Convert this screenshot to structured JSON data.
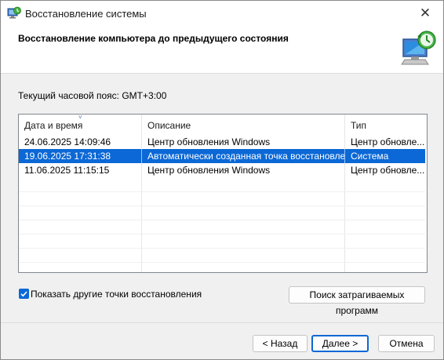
{
  "window": {
    "title": "Восстановление системы",
    "close_glyph": "✕",
    "icon": "system-restore-icon"
  },
  "header": {
    "title": "Восстановление компьютера до предыдущего состояния",
    "icon": "computer-restore-icon"
  },
  "timezone_label": "Текущий часовой пояс: GMT+3:00",
  "table": {
    "columns": [
      "Дата и время",
      "Описание",
      "Тип"
    ],
    "sort_indicator": "˅",
    "rows": [
      {
        "date": "24.06.2025 14:09:46",
        "description": "Центр обновления Windows",
        "type": "Центр обновле..."
      },
      {
        "date": "19.06.2025 17:31:38",
        "description": "Автоматически созданная точка восстановле...",
        "type": "Система"
      },
      {
        "date": "11.06.2025 11:15:15",
        "description": "Центр обновления Windows",
        "type": "Центр обновле..."
      }
    ],
    "selected_index": 1
  },
  "show_more_checkbox": {
    "label": "Показать другие точки восстановления",
    "checked": true
  },
  "buttons": {
    "search": "Поиск затрагиваемых программ",
    "back": "< Назад",
    "next": "Далее >",
    "cancel": "Отмена"
  },
  "colors": {
    "selection": "#0b68d6",
    "accent": "#0b68d6"
  }
}
